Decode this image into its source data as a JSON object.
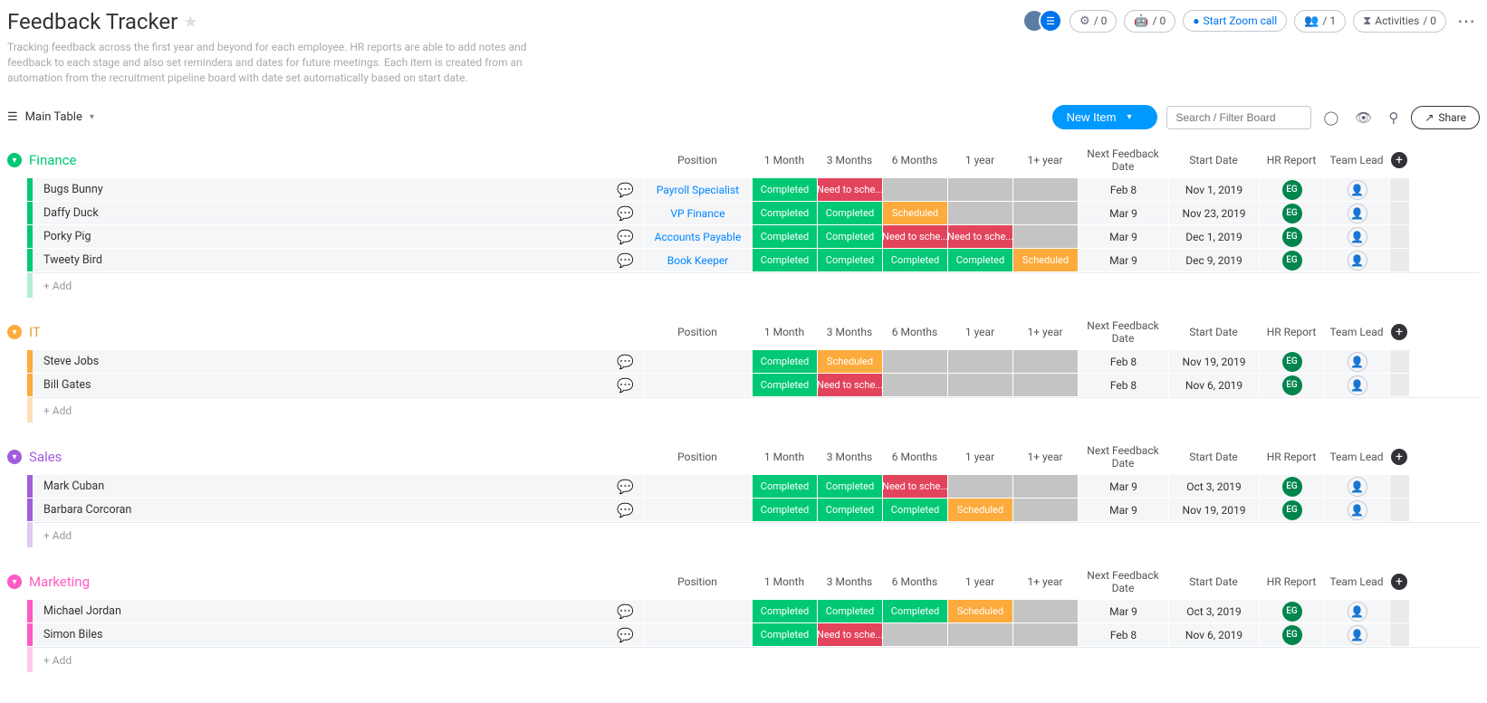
{
  "title": "Feedback Tracker",
  "description": "Tracking feedback across the first year and beyond for each employee. HR reports are able to add notes and feedback to each stage and also set reminders and dates for future meetings. Each item is created from an automation from the recruitment pipeline board with date set automatically based on start date.",
  "view_name": "Main Table",
  "header_pills": {
    "gears": "/ 0",
    "robot": "/ 0",
    "zoom": "Start Zoom call",
    "members": "/ 1",
    "activities_label": "Activities",
    "activities_count": "/ 0"
  },
  "toolbar": {
    "new_item": "New Item",
    "search_placeholder": "Search / Filter Board",
    "share": "Share"
  },
  "columns": [
    "Position",
    "1 Month",
    "3 Months",
    "6 Months",
    "1 year",
    "1+ year",
    "Next Feedback Date",
    "Start Date",
    "HR Report",
    "Team Lead"
  ],
  "add_row_label": "+ Add",
  "hr_badge": "EG",
  "groups": [
    {
      "id": "finance",
      "name": "Finance",
      "color_class": "finance",
      "rows": [
        {
          "name": "Bugs Bunny",
          "position": "Payroll Specialist",
          "statuses": [
            "completed",
            "need",
            "empty",
            "empty",
            "empty"
          ],
          "next": "Feb 8",
          "start": "Nov 1, 2019"
        },
        {
          "name": "Daffy Duck",
          "position": "VP Finance",
          "statuses": [
            "completed",
            "completed",
            "scheduled",
            "empty",
            "empty"
          ],
          "next": "Mar 9",
          "start": "Nov 23, 2019"
        },
        {
          "name": "Porky Pig",
          "position": "Accounts Payable",
          "statuses": [
            "completed",
            "completed",
            "need",
            "need",
            "empty"
          ],
          "next": "Mar 9",
          "start": "Dec 1, 2019"
        },
        {
          "name": "Tweety Bird",
          "position": "Book Keeper",
          "statuses": [
            "completed",
            "completed",
            "completed",
            "completed",
            "scheduled"
          ],
          "next": "Mar 9",
          "start": "Dec 9, 2019"
        }
      ]
    },
    {
      "id": "it",
      "name": "IT",
      "color_class": "it",
      "rows": [
        {
          "name": "Steve Jobs",
          "position": "",
          "statuses": [
            "completed",
            "scheduled",
            "empty",
            "empty",
            "empty"
          ],
          "next": "Feb 8",
          "start": "Nov 19, 2019"
        },
        {
          "name": "Bill Gates",
          "position": "",
          "statuses": [
            "completed",
            "need",
            "empty",
            "empty",
            "empty"
          ],
          "next": "Feb 8",
          "start": "Nov 6, 2019"
        }
      ]
    },
    {
      "id": "sales",
      "name": "Sales",
      "color_class": "sales",
      "rows": [
        {
          "name": "Mark Cuban",
          "position": "",
          "statuses": [
            "completed",
            "completed",
            "need",
            "empty",
            "empty"
          ],
          "next": "Mar 9",
          "start": "Oct 3, 2019"
        },
        {
          "name": "Barbara Corcoran",
          "position": "",
          "statuses": [
            "completed",
            "completed",
            "completed",
            "scheduled",
            "empty"
          ],
          "next": "Mar 9",
          "start": "Nov 19, 2019"
        }
      ]
    },
    {
      "id": "marketing",
      "name": "Marketing",
      "color_class": "marketing",
      "rows": [
        {
          "name": "Michael Jordan",
          "position": "",
          "statuses": [
            "completed",
            "completed",
            "completed",
            "scheduled",
            "empty"
          ],
          "next": "Mar 9",
          "start": "Oct 3, 2019"
        },
        {
          "name": "Simon Biles",
          "position": "",
          "statuses": [
            "completed",
            "need",
            "empty",
            "empty",
            "empty"
          ],
          "next": "Feb 8",
          "start": "Nov 6, 2019"
        }
      ]
    }
  ],
  "status_labels": {
    "completed": "Completed",
    "need": "Need to sche...",
    "scheduled": "Scheduled",
    "empty": ""
  }
}
